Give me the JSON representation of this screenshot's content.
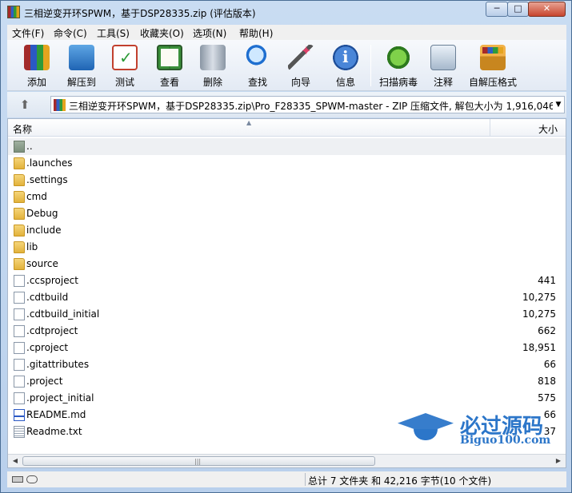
{
  "window": {
    "title": "三相逆变开环SPWM，基于DSP28335.zip (评估版本)",
    "min": "─",
    "max": "□",
    "close": "✕"
  },
  "menu": [
    "文件(F)",
    "命令(C)",
    "工具(S)",
    "收藏夹(O)",
    "选项(N)",
    "帮助(H)"
  ],
  "toolbar": [
    {
      "label": "添加",
      "icon": "add-archive-icon"
    },
    {
      "label": "解压到",
      "icon": "extract-folder-icon"
    },
    {
      "label": "测试",
      "icon": "test-checklist-icon"
    },
    {
      "label": "查看",
      "icon": "view-book-icon"
    },
    {
      "label": "删除",
      "icon": "trash-icon"
    },
    {
      "label": "查找",
      "icon": "magnifier-icon"
    },
    {
      "label": "向导",
      "icon": "wizard-wand-icon"
    },
    {
      "label": "信息",
      "icon": "info-icon"
    },
    {
      "label": "扫描病毒",
      "icon": "virus-scan-icon"
    },
    {
      "label": "注释",
      "icon": "comment-icon"
    },
    {
      "label": "自解压格式",
      "icon": "sfx-box-icon"
    }
  ],
  "address": {
    "up": "⬆",
    "path": "三相逆变开环SPWM，基于DSP28335.zip\\Pro_F28335_SPWM-master - ZIP 压缩文件, 解包大小为 1,916,046 字节",
    "dropdown": "▼"
  },
  "list": {
    "col_name": "名称",
    "col_size": "大小",
    "sort_caret": "▲",
    "rows": [
      {
        "name": "..",
        "size": "",
        "type": "up"
      },
      {
        "name": ".launches",
        "size": "",
        "type": "folder"
      },
      {
        "name": ".settings",
        "size": "",
        "type": "folder"
      },
      {
        "name": "cmd",
        "size": "",
        "type": "folder"
      },
      {
        "name": "Debug",
        "size": "",
        "type": "folder"
      },
      {
        "name": "include",
        "size": "",
        "type": "folder"
      },
      {
        "name": "lib",
        "size": "",
        "type": "folder"
      },
      {
        "name": "source",
        "size": "",
        "type": "folder"
      },
      {
        "name": ".ccsproject",
        "size": "441",
        "type": "file"
      },
      {
        "name": ".cdtbuild",
        "size": "10,275",
        "type": "file"
      },
      {
        "name": ".cdtbuild_initial",
        "size": "10,275",
        "type": "file"
      },
      {
        "name": ".cdtproject",
        "size": "662",
        "type": "file"
      },
      {
        "name": ".cproject",
        "size": "18,951",
        "type": "file"
      },
      {
        "name": ".gitattributes",
        "size": "66",
        "type": "file"
      },
      {
        "name": ".project",
        "size": "818",
        "type": "file"
      },
      {
        "name": ".project_initial",
        "size": "575",
        "type": "file"
      },
      {
        "name": "README.md",
        "size": "66",
        "type": "rtf"
      },
      {
        "name": "Readme.txt",
        "size": "37",
        "type": "txt"
      }
    ]
  },
  "scroll": {
    "left": "◀",
    "right": "▶",
    "grip": "|||"
  },
  "watermark": {
    "title": "必过源码",
    "site": "Biguo100.com"
  },
  "status": {
    "text": "总计 7 文件夹 和 42,216 字节(10 个文件)"
  }
}
